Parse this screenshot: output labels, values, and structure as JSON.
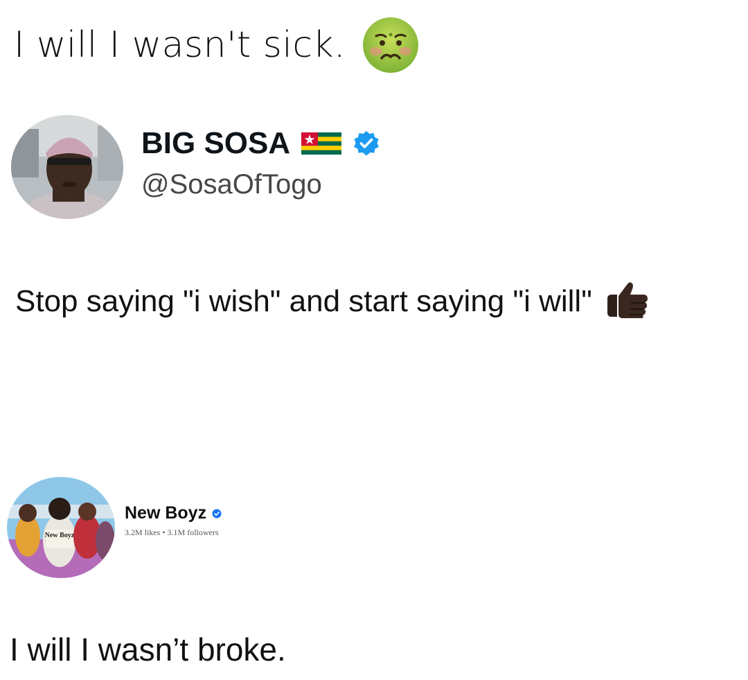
{
  "top_caption": {
    "text": "I will I wasn't sick.",
    "emoji_icon": "nauseated-face-icon"
  },
  "tweet": {
    "display_name": "BIG SOSA",
    "flag_icon": "togo-flag-icon",
    "verified_icon": "verified-badge-icon",
    "handle": "@SosaOfTogo",
    "body": "Stop saying \"i wish\" and start saying \"i will\"",
    "body_emoji_icon": "thumbs-up-icon",
    "verified_color": "#1d9bf0"
  },
  "facebook_post": {
    "page_name": "New Boyz",
    "verified_icon": "verified-badge-icon",
    "stats": "3.2M likes • 3.1M followers",
    "avatar_logo_text": "New Boyz",
    "verified_color": "#1877f2"
  },
  "bottom_caption": {
    "text": "I will I wasn’t broke."
  }
}
